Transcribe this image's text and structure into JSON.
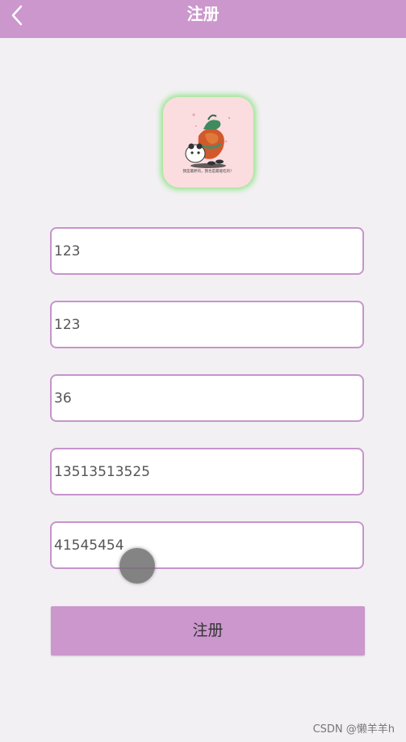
{
  "header": {
    "title": "注册",
    "back_icon": "chevron-left-icon"
  },
  "avatar": {
    "caption": "我是最胖的，我也是最能吃的！"
  },
  "form": {
    "fields": [
      {
        "value": "123"
      },
      {
        "value": "123"
      },
      {
        "value": "36"
      },
      {
        "value": "13513513525"
      },
      {
        "value": "41545454"
      }
    ],
    "submit_label": "注册"
  },
  "watermark": "CSDN @懒羊羊h",
  "colors": {
    "accent": "#cb97cd",
    "field_border": "#c794cb",
    "background": "#f2f0f3",
    "avatar_glow": "#97e58f"
  }
}
